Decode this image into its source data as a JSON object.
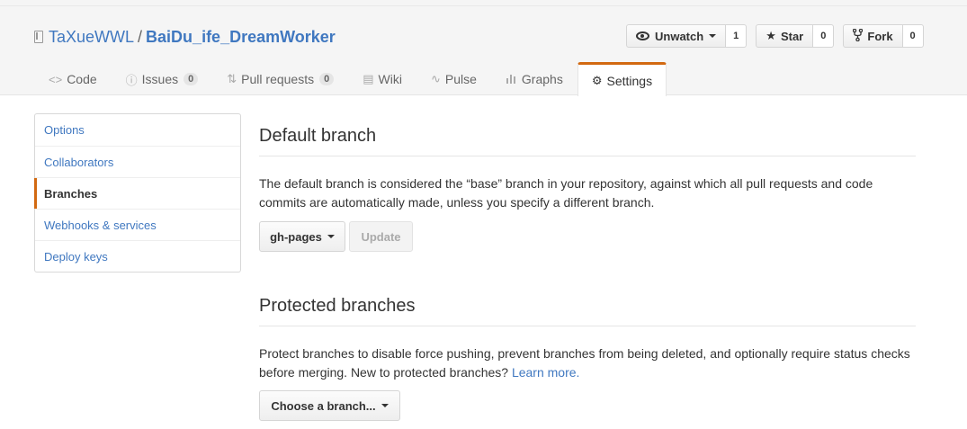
{
  "repo": {
    "owner": "TaXueWWL",
    "separator": "/",
    "name": "BaiDu_ife_DreamWorker"
  },
  "actions": {
    "watch": {
      "label": "Unwatch",
      "count": "1"
    },
    "star": {
      "label": "Star",
      "count": "0"
    },
    "fork": {
      "label": "Fork",
      "count": "0"
    }
  },
  "tabs": [
    {
      "label": "Code",
      "icon": "code-icon"
    },
    {
      "label": "Issues",
      "icon": "issue-icon",
      "count": "0"
    },
    {
      "label": "Pull requests",
      "icon": "pull-request-icon",
      "count": "0"
    },
    {
      "label": "Wiki",
      "icon": "book-icon"
    },
    {
      "label": "Pulse",
      "icon": "pulse-icon"
    },
    {
      "label": "Graphs",
      "icon": "graph-icon"
    },
    {
      "label": "Settings",
      "icon": "gear-icon",
      "selected": true
    }
  ],
  "sidebar": {
    "items": [
      {
        "label": "Options"
      },
      {
        "label": "Collaborators"
      },
      {
        "label": "Branches",
        "selected": true
      },
      {
        "label": "Webhooks & services"
      },
      {
        "label": "Deploy keys"
      }
    ]
  },
  "default_branch": {
    "heading": "Default branch",
    "description": "The default branch is considered the “base” branch in your repository, against which all pull requests and code commits are automatically made, unless you specify a different branch.",
    "branch_select": "gh-pages",
    "update_label": "Update"
  },
  "protected_branches": {
    "heading": "Protected branches",
    "description": "Protect branches to disable force pushing, prevent branches from being deleted, and optionally require status checks before merging. New to protected branches?",
    "learn_more": "Learn more.",
    "choose_label": "Choose a branch..."
  },
  "colors": {
    "accent": "#d26911",
    "link": "#4078c0"
  }
}
